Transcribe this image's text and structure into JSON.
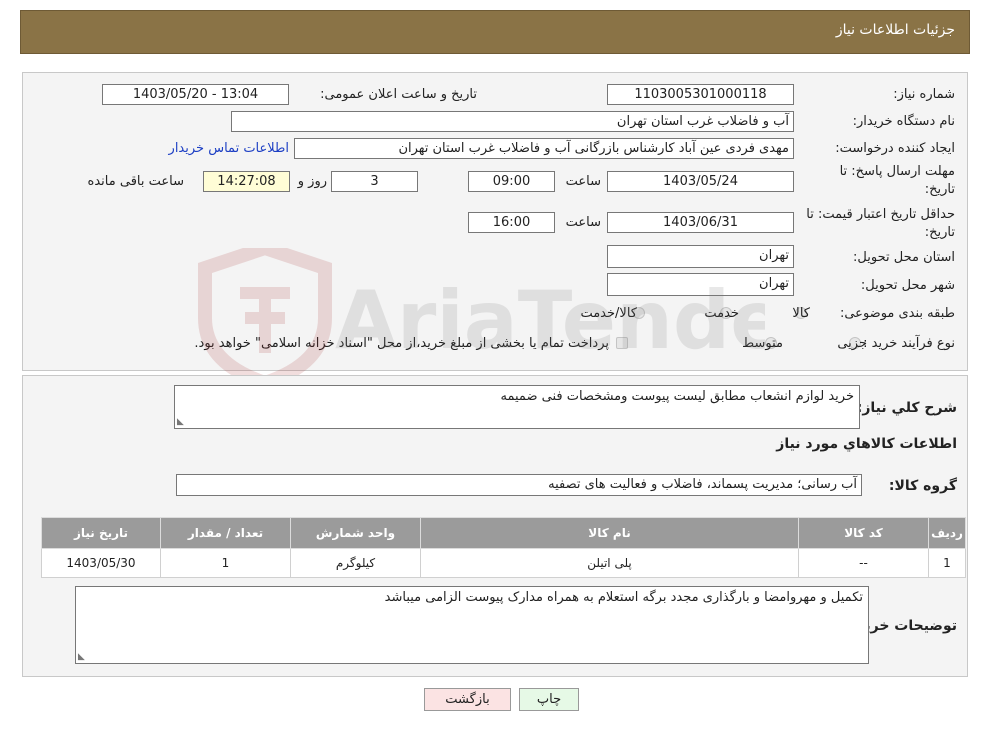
{
  "page_title": "جزئیات اطلاعات نیاز",
  "fields": {
    "need_number_label": "شماره نیاز:",
    "need_number": "1103005301000118",
    "announce_label": "تاریخ و ساعت اعلان عمومی:",
    "announce_value": "1403/05/20 - 13:04",
    "buyer_org_label": "نام دستگاه خریدار:",
    "buyer_org": "آب و فاضلاب غرب استان تهران",
    "creator_label": "ایجاد کننده درخواست:",
    "creator": "مهدی فردی عین آباد کارشناس بازرگانی آب و فاضلاب غرب استان تهران",
    "contact_link": "اطلاعات تماس خریدار",
    "deadline_label_1": "مهلت ارسال پاسخ: تا",
    "deadline_label_2": "تاریخ:",
    "deadline_date": "1403/05/24",
    "time_label": "ساعت",
    "deadline_time": "09:00",
    "days_value": "3",
    "days_label": "روز و",
    "remaining_time": "14:27:08",
    "remaining_label": "ساعت باقی مانده",
    "validity_label_1": "حداقل تاریخ اعتبار قیمت: تا",
    "validity_label_2": "تاریخ:",
    "validity_date": "1403/06/31",
    "validity_time": "16:00",
    "province_label": "استان محل تحویل:",
    "province": "تهران",
    "city_label": "شهر محل تحویل:",
    "city": "تهران",
    "category_label": "طبقه بندی موضوعی:",
    "category_options": [
      "کالا",
      "خدمت",
      "کالا/خدمت"
    ],
    "purchase_type_label": "نوع فرآیند خرید :",
    "purchase_options": [
      "جزیی",
      "متوسط"
    ],
    "purchase_note": "پرداخت تمام یا بخشی از مبلغ خرید،از محل \"اسناد خزانه اسلامی\" خواهد بود."
  },
  "summary": {
    "label": "شرح کلي نياز:",
    "value": "خرید لوازم انشعاب مطابق لیست پیوست ومشخصات فنی ضمیمه"
  },
  "goods_section_title": "اطلاعات کالاهاي مورد نياز",
  "goods_group": {
    "label": "گروه کالا:",
    "value": "آب رسانی؛ مدیریت پسماند، فاضلاب و فعالیت های تصفیه"
  },
  "table": {
    "headers": [
      "ردیف",
      "کد کالا",
      "نام کالا",
      "واحد شمارش",
      "تعداد / مقدار",
      "تاریخ نیاز"
    ],
    "rows": [
      [
        "1",
        "--",
        "پلی اتیلن",
        "کیلوگرم",
        "1",
        "1403/05/30"
      ]
    ]
  },
  "buyer_notes": {
    "label": "توضیحات خریدار:",
    "value": "تکمیل و مهروامضا و بارگذاری مجدد برگه استعلام به همراه مدارک پیوست الزامی میباشد"
  },
  "buttons": {
    "print": "چاپ",
    "back": "بازگشت"
  },
  "watermark_text": "AriaTender.neT",
  "colors": {
    "header": "#8a7346",
    "table_header": "#9b9b9b",
    "highlight": "#fffdd6",
    "back_button": "#fbe3e3",
    "print_button": "#e6f9e6",
    "link": "#1d3fc4"
  }
}
